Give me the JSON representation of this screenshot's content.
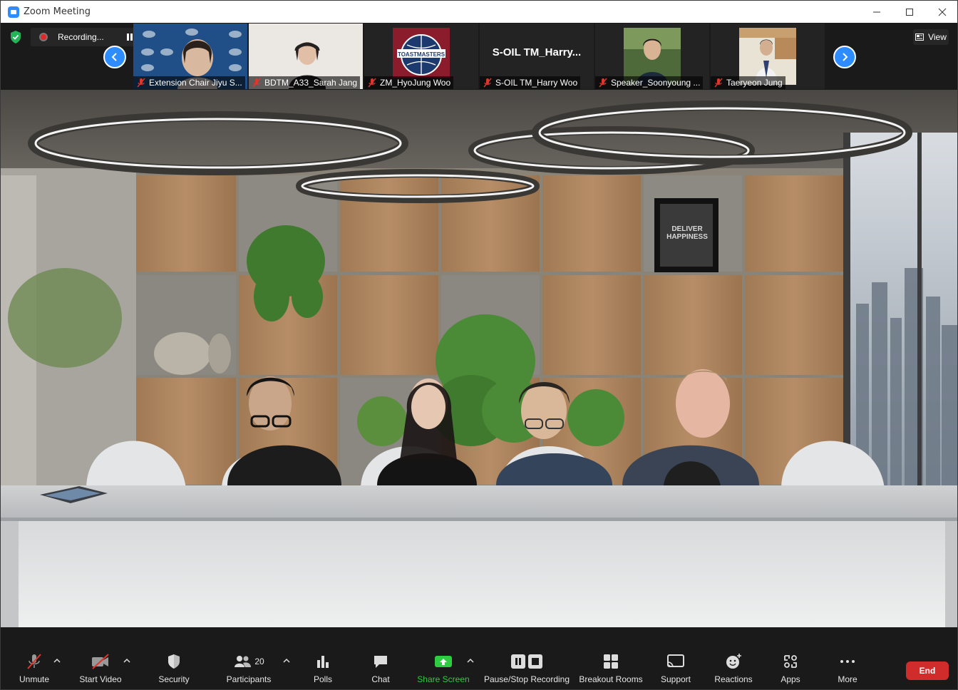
{
  "window": {
    "title": "Zoom Meeting"
  },
  "recording": {
    "label": "Recording..."
  },
  "view": {
    "label": "View"
  },
  "thumbnails": [
    {
      "name": "Extension Chair Jiyu S..."
    },
    {
      "name": "BDTM_A33_Sarah Jang"
    },
    {
      "name": "ZM_HyoJung Woo",
      "logo_text": "TOASTMASTERS"
    },
    {
      "name": "S-OIL TM_Harry Woo",
      "display": "S-OIL  TM_Harry..."
    },
    {
      "name": "Speaker_Soonyoung ..."
    },
    {
      "name": "Taeryeon Jung"
    }
  ],
  "stage": {
    "poster_text_1": "DELIVER",
    "poster_text_2": "HAPPINESS"
  },
  "toolbar": {
    "unmute": "Unmute",
    "start_video": "Start Video",
    "security": "Security",
    "participants": "Participants",
    "participants_count": "20",
    "polls": "Polls",
    "chat": "Chat",
    "share_screen": "Share Screen",
    "pause_stop_recording": "Pause/Stop Recording",
    "breakout_rooms": "Breakout Rooms",
    "support": "Support",
    "reactions": "Reactions",
    "apps": "Apps",
    "more": "More",
    "end": "End"
  },
  "colors": {
    "accent": "#2d8cff",
    "end": "#d12c2c",
    "share": "#2ecc40",
    "mute": "#e0352b"
  }
}
